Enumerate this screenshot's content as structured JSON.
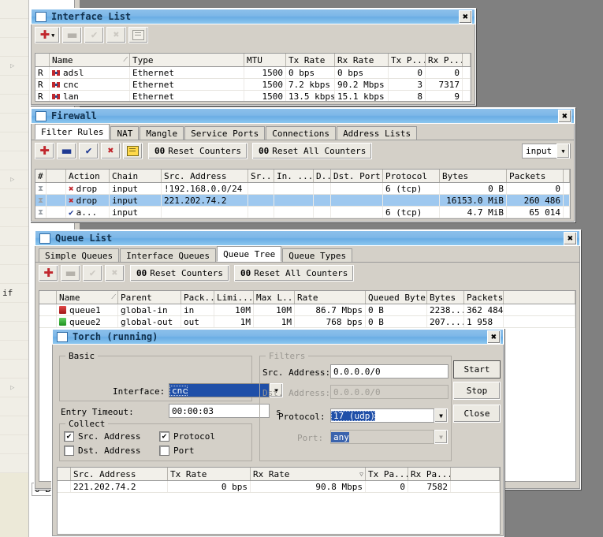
{
  "background_app": {
    "menu_items": [
      "",
      "",
      "",
      "",
      "",
      "",
      "",
      "",
      "",
      "",
      "",
      "",
      "",
      "",
      "",
      "if",
      "",
      "",
      "",
      "",
      "",
      "",
      "",
      "",
      "",
      ""
    ],
    "arrow_glyph": "▷",
    "status_value": "0 B"
  },
  "interface_list": {
    "title": "Interface List",
    "close_label": "✖",
    "toolbar": {
      "add_label": "✚",
      "add_caret": "▼",
      "remove_label": "▬",
      "enable_label": "✔",
      "disable_label": "✖",
      "comment_label": "note-icon"
    },
    "columns": [
      "",
      "Name",
      "Type",
      "MTU",
      "Tx Rate",
      "Rx Rate",
      "Tx P...",
      "Rx P...",
      ""
    ],
    "sort_indicator": "⟋",
    "rows": [
      {
        "flag": "R",
        "name": "adsl",
        "type": "Ethernet",
        "mtu": "1500",
        "tx_rate": "0 bps",
        "rx_rate": "0 bps",
        "tx_packets": "0",
        "rx_packets": "0"
      },
      {
        "flag": "R",
        "name": "cnc",
        "type": "Ethernet",
        "mtu": "1500",
        "tx_rate": "7.2 kbps",
        "rx_rate": "90.2 Mbps",
        "tx_packets": "3",
        "rx_packets": "7317"
      },
      {
        "flag": "R",
        "name": "lan",
        "type": "Ethernet",
        "mtu": "1500",
        "tx_rate": "13.5 kbps",
        "rx_rate": "15.1 kbps",
        "tx_packets": "8",
        "rx_packets": "9"
      }
    ]
  },
  "firewall": {
    "title": "Firewall",
    "close_label": "✖",
    "tabs": [
      {
        "label": "Filter Rules",
        "active": true
      },
      {
        "label": "NAT",
        "active": false
      },
      {
        "label": "Mangle",
        "active": false
      },
      {
        "label": "Service Ports",
        "active": false
      },
      {
        "label": "Connections",
        "active": false
      },
      {
        "label": "Address Lists",
        "active": false
      }
    ],
    "toolbar": {
      "add_label": "✚",
      "remove_label": "▬",
      "enable_label": "✔",
      "disable_label": "✖",
      "comment_label": "note-icon",
      "reset_counters_prefix": "00",
      "reset_counters_label": "Reset Counters",
      "reset_all_prefix": "00",
      "reset_all_label": "Reset All Counters",
      "chain_filter_value": "input",
      "chain_filter_caret": "▼"
    },
    "columns": [
      "#",
      "Action",
      "Chain",
      "Src. Address",
      "Sr...",
      "In. ...",
      "D..",
      "Dst. Port",
      "Protocol",
      "Bytes",
      "Packets",
      ""
    ],
    "rows": [
      {
        "num": "",
        "action": "drop",
        "action_icon": "x-drop-icon",
        "chain": "input",
        "src_address": "!192.168.0.0/24",
        "src_port": "",
        "in_iface": "",
        "dst": "",
        "dst_port": "",
        "protocol": "6 (tcp)",
        "bytes": "0 B",
        "packets": "0",
        "selected": false
      },
      {
        "num": "",
        "action": "drop",
        "action_icon": "x-drop-icon",
        "chain": "input",
        "src_address": "221.202.74.2",
        "src_port": "",
        "in_iface": "",
        "dst": "",
        "dst_port": "",
        "protocol": "",
        "bytes": "16153.0 MiB",
        "packets": "260 486",
        "selected": true
      },
      {
        "num": "",
        "action": "a...",
        "action_icon": "check-accept-icon",
        "chain": "input",
        "src_address": "",
        "src_port": "",
        "in_iface": "",
        "dst": "",
        "dst_port": "",
        "protocol": "6 (tcp)",
        "bytes": "4.7 MiB",
        "packets": "65 014",
        "selected": false
      }
    ]
  },
  "queue_list": {
    "title": "Queue List",
    "close_label": "✖",
    "tabs": [
      {
        "label": "Simple Queues",
        "active": false
      },
      {
        "label": "Interface Queues",
        "active": false
      },
      {
        "label": "Queue Tree",
        "active": true
      },
      {
        "label": "Queue Types",
        "active": false
      }
    ],
    "toolbar": {
      "add_label": "✚",
      "remove_label": "▬",
      "enable_label": "✔",
      "disable_label": "✖",
      "reset_counters_prefix": "00",
      "reset_counters_label": "Reset Counters",
      "reset_all_prefix": "00",
      "reset_all_label": "Reset All Counters"
    },
    "columns": [
      "",
      "Name",
      "Parent",
      "Pack...",
      "Limi...",
      "Max L...",
      "Rate",
      "Queued Bytes",
      "Bytes",
      "Packets",
      ""
    ],
    "sort_indicator": "⟋",
    "rows": [
      {
        "icon": "queue-red-icon",
        "name": "queue1",
        "parent": "global-in",
        "packet_marks": "in",
        "limit_at": "10M",
        "max_limit": "10M",
        "rate": "86.7 Mbps",
        "queued_bytes": "0 B",
        "bytes": "2238...",
        "packets": "362 484"
      },
      {
        "icon": "queue-green-icon",
        "name": "queue2",
        "parent": "global-out",
        "packet_marks": "out",
        "limit_at": "1M",
        "max_limit": "1M",
        "rate": "768 bps",
        "queued_bytes": "0 B",
        "bytes": "207....",
        "packets": "1 958"
      }
    ]
  },
  "torch": {
    "title": "Torch (running)",
    "close_label": "✖",
    "groups": {
      "basic": "Basic",
      "collect": "Collect",
      "filters": "Filters"
    },
    "fields": {
      "interface_label": "Interface:",
      "interface_value": "cnc",
      "entry_timeout_label": "Entry Timeout:",
      "entry_timeout_value": "00:00:03",
      "entry_timeout_unit": "s",
      "src_address_label": "Src. Address:",
      "src_address_value": "0.0.0.0/0",
      "dst_address_label": "Dst. Address:",
      "dst_address_value": "0.0.0.0/0",
      "protocol_label": "Protocol:",
      "protocol_value": "17 (udp)",
      "port_label": "Port:",
      "port_value": "any",
      "dropdown_caret": "▼"
    },
    "collect": [
      {
        "label": "Src. Address",
        "checked": true
      },
      {
        "label": "Dst. Address",
        "checked": false
      },
      {
        "label": "Protocol",
        "checked": true
      },
      {
        "label": "Port",
        "checked": false
      }
    ],
    "check_glyph": "✔",
    "buttons": {
      "start": "Start",
      "stop": "Stop",
      "close": "Close"
    },
    "columns": [
      "",
      "Src. Address",
      "Tx Rate",
      "Rx Rate",
      "Tx Pa...",
      "Rx Pa...",
      ""
    ],
    "sort_indicator": "▽",
    "rows": [
      {
        "src_address": "221.202.74.2",
        "tx_rate": "0 bps",
        "rx_rate": "90.8 Mbps",
        "tx_packets": "0",
        "rx_packets": "7582"
      }
    ]
  }
}
